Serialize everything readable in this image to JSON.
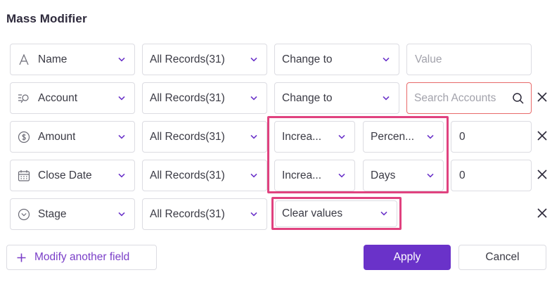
{
  "title": "Mass Modifier",
  "rows": [
    {
      "field": {
        "label": "Name",
        "icon": "text-icon"
      },
      "scope": "All Records(31)",
      "action": "Change to",
      "value_placeholder": "Value"
    },
    {
      "field": {
        "label": "Account",
        "icon": "lookup-icon"
      },
      "scope": "All Records(31)",
      "action": "Change to",
      "value_placeholder": "Search Accounts"
    },
    {
      "field": {
        "label": "Amount",
        "icon": "currency-icon"
      },
      "scope": "All Records(31)",
      "action": "Increa...",
      "unit": "Percen...",
      "value": "0"
    },
    {
      "field": {
        "label": "Close Date",
        "icon": "calendar-icon"
      },
      "scope": "All Records(31)",
      "action": "Increa...",
      "unit": "Days",
      "value": "0"
    },
    {
      "field": {
        "label": "Stage",
        "icon": "dropdown-circle-icon"
      },
      "scope": "All Records(31)",
      "action": "Clear values"
    }
  ],
  "buttons": {
    "modify": "Modify another field",
    "apply": "Apply",
    "cancel": "Cancel"
  },
  "colors": {
    "accent": "#6a32c9",
    "highlight": "#e0427f",
    "error_border": "#e86a6a"
  }
}
